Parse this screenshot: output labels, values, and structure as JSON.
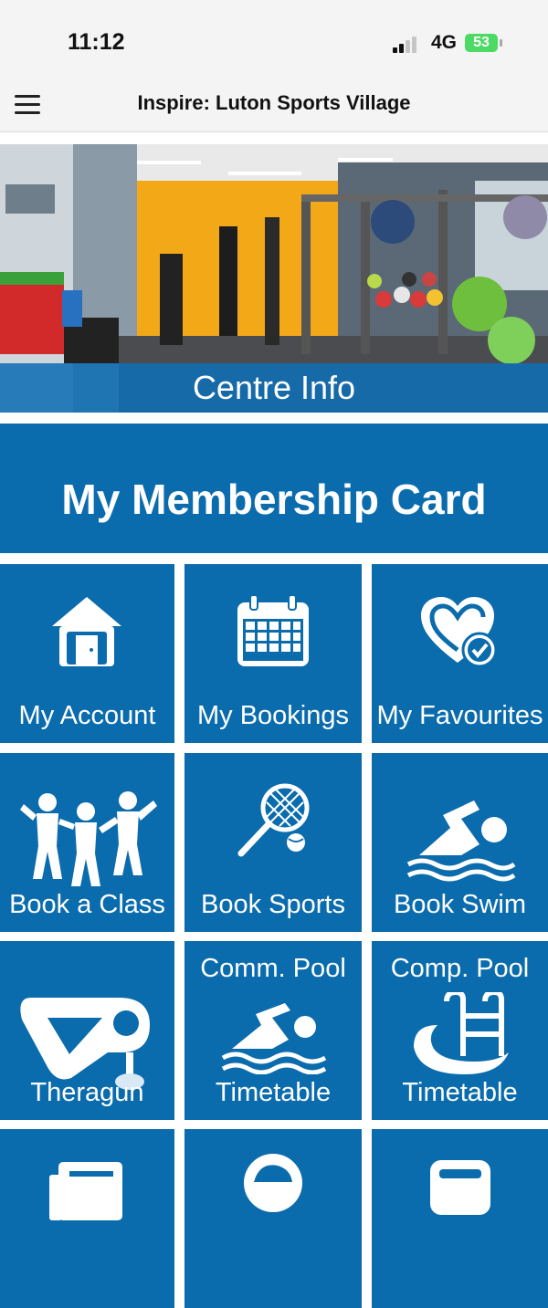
{
  "status_bar": {
    "time": "11:12",
    "network": "4G",
    "battery": "53"
  },
  "app_bar": {
    "title": "Inspire: Luton Sports Village"
  },
  "hero": {
    "label": "Centre Info"
  },
  "membership": {
    "label": "My Membership Card"
  },
  "tiles": [
    {
      "label": "My Account",
      "icon": "house-icon"
    },
    {
      "label": "My Bookings",
      "icon": "calendar-icon"
    },
    {
      "label": "My Favourites",
      "icon": "heart-check-icon"
    },
    {
      "label": "Book a Class",
      "icon": "dancers-icon"
    },
    {
      "label": "Book Sports",
      "icon": "tennis-icon"
    },
    {
      "label": "Book Swim",
      "icon": "swimmer-icon"
    },
    {
      "label": "Theragun",
      "icon": "theragun-icon"
    },
    {
      "label_top": "Comm. Pool",
      "label": "Timetable",
      "icon": "swimmer-icon"
    },
    {
      "label_top": "Comp. Pool",
      "label": "Timetable",
      "icon": "pool-ladder-icon"
    }
  ],
  "colors": {
    "tile_blue": "#0a6cad",
    "status_bg": "#f4f4f4",
    "battery_green": "#4cd964"
  }
}
